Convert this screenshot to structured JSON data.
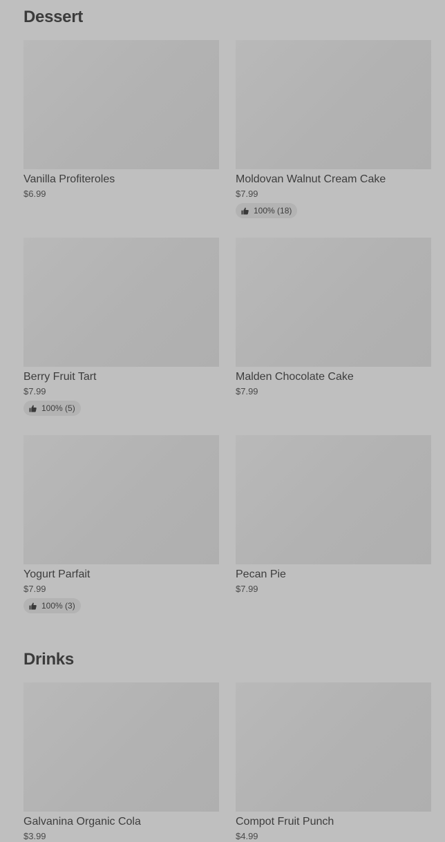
{
  "sections": [
    {
      "title": "Dessert",
      "items": [
        {
          "name": "Vanilla Profiteroles",
          "price": "$6.99",
          "rating": ""
        },
        {
          "name": "Moldovan Walnut Cream Cake",
          "price": "$7.99",
          "rating": "100% (18)"
        },
        {
          "name": "Berry Fruit Tart",
          "price": "$7.99",
          "rating": "100% (5)"
        },
        {
          "name": "Malden Chocolate Cake",
          "price": "$7.99",
          "rating": ""
        },
        {
          "name": "Yogurt Parfait",
          "price": "$7.99",
          "rating": "100% (3)"
        },
        {
          "name": "Pecan Pie",
          "price": "$7.99",
          "rating": ""
        }
      ]
    },
    {
      "title": "Drinks",
      "items": [
        {
          "name": "Galvanina Organic Cola",
          "price": "$3.99",
          "rating": ""
        },
        {
          "name": "Compot Fruit Punch",
          "price": "$4.99",
          "rating": ""
        }
      ]
    }
  ],
  "icons": {
    "rating": "thumbs-up-icon"
  }
}
